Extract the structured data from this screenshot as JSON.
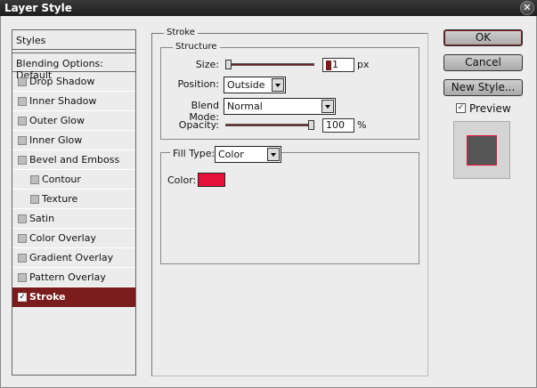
{
  "window": {
    "title": "Layer Style",
    "close_glyph": "✕"
  },
  "styles_panel": {
    "header": "Styles",
    "blending_options": "Blending Options: Default",
    "items": [
      {
        "label": "Drop Shadow",
        "checked": false,
        "indent": false
      },
      {
        "label": "Inner Shadow",
        "checked": false,
        "indent": false
      },
      {
        "label": "Outer Glow",
        "checked": false,
        "indent": false
      },
      {
        "label": "Inner Glow",
        "checked": false,
        "indent": false
      },
      {
        "label": "Bevel and Emboss",
        "checked": false,
        "indent": false
      },
      {
        "label": "Contour",
        "checked": false,
        "indent": true
      },
      {
        "label": "Texture",
        "checked": false,
        "indent": true
      },
      {
        "label": "Satin",
        "checked": false,
        "indent": false
      },
      {
        "label": "Color Overlay",
        "checked": false,
        "indent": false
      },
      {
        "label": "Gradient Overlay",
        "checked": false,
        "indent": false
      },
      {
        "label": "Pattern Overlay",
        "checked": false,
        "indent": false
      },
      {
        "label": "Stroke",
        "checked": true,
        "indent": false,
        "selected": true
      }
    ]
  },
  "stroke": {
    "group_title": "Stroke",
    "structure_title": "Structure",
    "size": {
      "label": "Size:",
      "value": "1",
      "unit": "px",
      "slider_fraction": 0.0
    },
    "position": {
      "label": "Position:",
      "value": "Outside"
    },
    "blend_mode": {
      "label": "Blend Mode:",
      "value": "Normal"
    },
    "opacity": {
      "label": "Opacity:",
      "value": "100",
      "unit": "%",
      "slider_fraction": 1.0
    },
    "fill_type": {
      "label": "Fill Type:",
      "value": "Color"
    },
    "color": {
      "label": "Color:",
      "hex": "#e6113a"
    }
  },
  "buttons": {
    "ok": "OK",
    "cancel": "Cancel",
    "new_style": "New Style..."
  },
  "preview": {
    "label": "Preview",
    "checked": true
  },
  "colors": {
    "accent": "#7a1c1c",
    "stroke_color": "#e6113a"
  }
}
